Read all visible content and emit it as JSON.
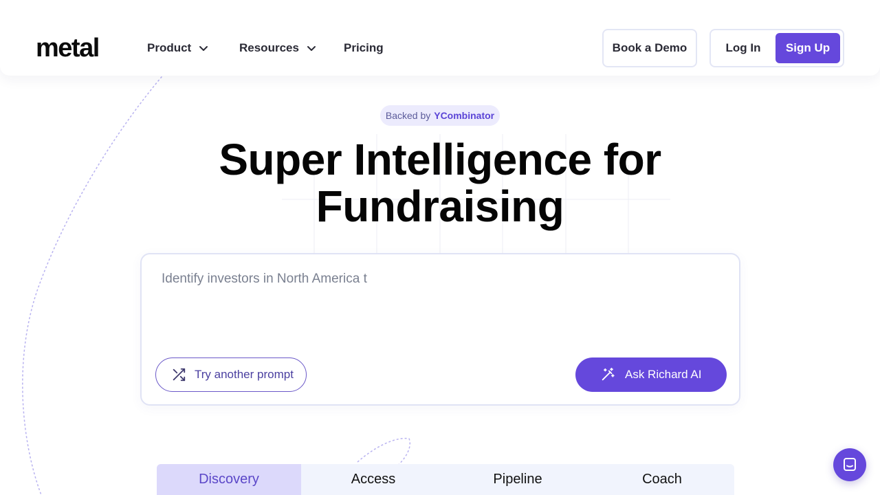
{
  "header": {
    "logo_text": "metal",
    "nav": [
      {
        "label": "Product",
        "has_dropdown": true
      },
      {
        "label": "Resources",
        "has_dropdown": true
      },
      {
        "label": "Pricing",
        "has_dropdown": false
      }
    ],
    "book_demo_label": "Book a Demo",
    "login_label": "Log In",
    "signup_label": "Sign Up"
  },
  "hero": {
    "badge_prefix": "Backed by",
    "badge_brand": "YCombinator",
    "title_line1": "Super Intelligence for",
    "title_line2": "Fundraising"
  },
  "prompt": {
    "value": "Identify investors in North America t",
    "try_label": "Try another prompt",
    "try_icon": "shuffle-icon",
    "ask_label": "Ask Richard AI",
    "ask_icon": "magic-wand-icon"
  },
  "tabs": [
    {
      "label": "Discovery",
      "active": true
    },
    {
      "label": "Access",
      "active": false
    },
    {
      "label": "Pipeline",
      "active": false
    },
    {
      "label": "Coach",
      "active": false
    }
  ],
  "chat": {
    "icon": "chat-icon"
  },
  "colors": {
    "accent": "#6548dc",
    "accent_light": "#ecebfd",
    "tab_active_bg": "#dcd9fb",
    "tab_bg": "#f1f4fd",
    "border": "#e0e3f5"
  }
}
